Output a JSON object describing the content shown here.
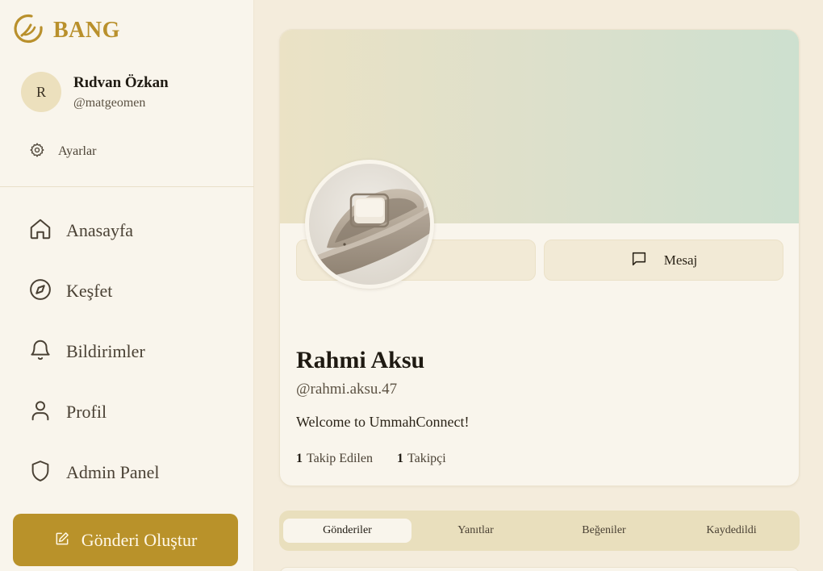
{
  "brand": {
    "name": "BANG",
    "icon": "crescent-logo-icon"
  },
  "current_user": {
    "initial": "R",
    "name": "Rıdvan Özkan",
    "handle": "@matgeomen"
  },
  "settings": {
    "label": "Ayarlar",
    "icon": "gear-icon"
  },
  "nav": {
    "items": [
      {
        "label": "Anasayfa",
        "icon": "home-icon"
      },
      {
        "label": "Keşfet",
        "icon": "compass-icon"
      },
      {
        "label": "Bildirimler",
        "icon": "bell-icon"
      },
      {
        "label": "Profil",
        "icon": "user-icon"
      },
      {
        "label": "Admin Panel",
        "icon": "shield-icon"
      }
    ]
  },
  "create_post": {
    "label": "Gönderi Oluştur",
    "icon": "edit-icon"
  },
  "profile": {
    "name": "Rahmi Aksu",
    "handle": "@rahmi.aksu.47",
    "bio": "Welcome to UmmahConnect!",
    "following_count": "1",
    "following_label": "Takip Edilen",
    "followers_count": "1",
    "followers_label": "Takipçi",
    "message_label": "Mesaj",
    "message_icon": "message-icon"
  },
  "tabs": [
    {
      "label": "Gönderiler",
      "active": true
    },
    {
      "label": "Yanıtlar",
      "active": false
    },
    {
      "label": "Beğeniler",
      "active": false
    },
    {
      "label": "Kaydedildi",
      "active": false
    }
  ],
  "colors": {
    "accent": "#b9922a",
    "sidebar_bg": "#f9f5ec",
    "page_bg": "#f4ecdc",
    "tab_bar_bg": "#e9dfbd"
  }
}
